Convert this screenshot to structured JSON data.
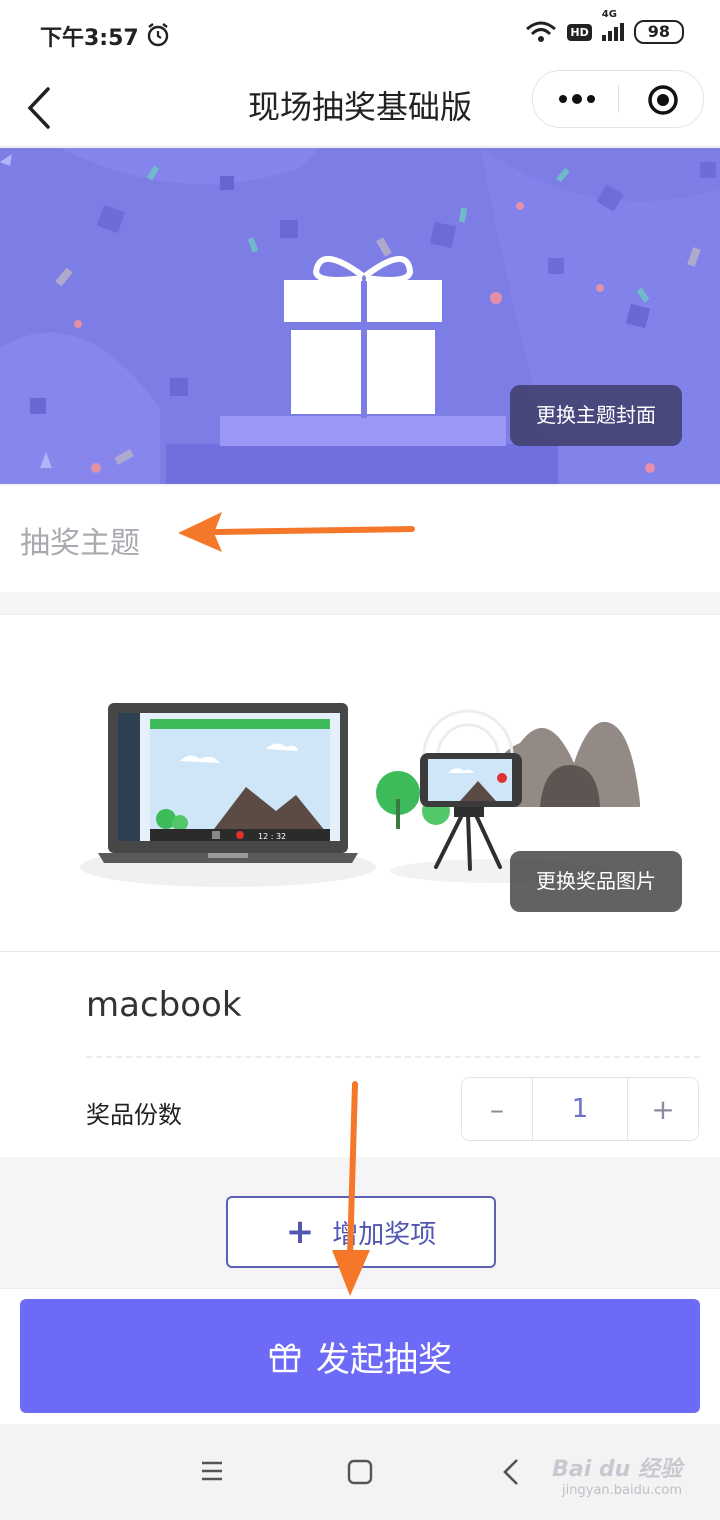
{
  "status": {
    "time": "下午3:57",
    "hd": "HD",
    "net": "4G",
    "battery": "98"
  },
  "nav": {
    "title": "现场抽奖基础版"
  },
  "banner": {
    "change_cover": "更换主题封面"
  },
  "theme": {
    "placeholder": "抽奖主题"
  },
  "prize": {
    "change_image": "更换奖品图片",
    "name": "macbook",
    "count_label": "奖品份数",
    "count_value": "1",
    "minus": "–",
    "plus": "+",
    "video_time": "12 : 32"
  },
  "add_prize": {
    "icon": "+",
    "label": "增加奖项"
  },
  "footer": {
    "start_label": "发起抽奖"
  },
  "watermark": {
    "brand": "Bai du 经验",
    "url": "jingyan.baidu.com"
  },
  "colors": {
    "primary": "#6d6af8",
    "banner": "#7e7ee8",
    "arrow": "#f5782a",
    "outline": "#5d61b8"
  }
}
